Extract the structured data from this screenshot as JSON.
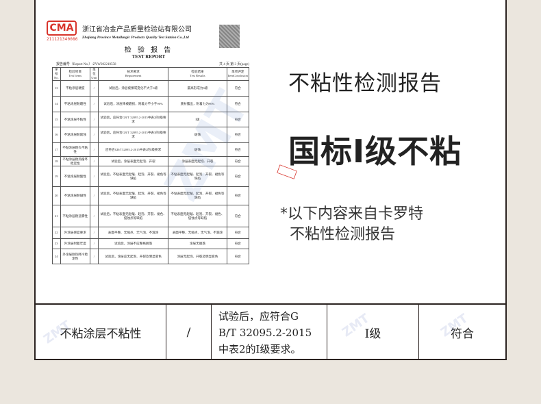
{
  "report": {
    "logo_text": "CMA",
    "logo_number": "211121340086",
    "org_cn": "浙江省冶金产品质量检验站有限公司",
    "org_en": "Zhejiang Province Metallurgic Products Quality Test Station Co.,Ltd",
    "title_cn": "检 验 报 告",
    "title_en": "TEST REPORT",
    "report_no": "报告编号（Report No.）:ZYW202210558",
    "page_info": "共 4 页 第 3 页(page)",
    "headers": [
      "序号\nNo.",
      "检验项目\nTest Items",
      "单位\nUnit",
      "技术要求\nRequirement",
      "检验结果\nTest Results",
      "单项评定\nItemConclusion"
    ],
    "rows": [
      {
        "no": "13",
        "item": "不粘涂层硬度",
        "unit": "/",
        "req": "试验后，涂层被擦或变化不大于6级",
        "result": "最高形成为6级",
        "conclusion": "符合"
      },
      {
        "no": "14",
        "item": "不粘涂层耐磨性",
        "unit": "/",
        "req": "试验后，涂层未被磨损，附着力不小于90%",
        "result": "底材露出，附着力为90%",
        "conclusion": "符合"
      },
      {
        "no": "15",
        "item": "不粘涂层不粘性",
        "unit": "/",
        "req": "试验后，应符合GB/T 32095.2-2015中表2的I级要求",
        "result": "I级",
        "conclusion": "符合"
      },
      {
        "no": "16",
        "item": "不粘涂层耐腐蚀",
        "unit": "/",
        "req": "试验后，应符合GB/T 32095.2-2015中表3的I级要求",
        "result": "斑蚀",
        "conclusion": "符合"
      },
      {
        "no": "17",
        "item": "不粘涂层耐久不粘性",
        "unit": "/",
        "req": "应符合GB/T32095.2-2015中表2的I级要求",
        "result": "斑蚀",
        "conclusion": "符合"
      },
      {
        "no": "18",
        "item": "不粘涂层耐热循环稳定性",
        "unit": "/",
        "req": "试验后，涂层表面无起泡、开裂",
        "result": "涂层表面无起泡、开裂",
        "conclusion": "符合"
      },
      {
        "no": "19",
        "item": "不粘涂层耐酸性",
        "unit": "/",
        "req": "试验后，不粘表面无起皱、起泡、开裂、褪色等缺陷",
        "result": "不粘表面无起皱、起泡、开裂、褪色等缺陷",
        "conclusion": "符合"
      },
      {
        "no": "20",
        "item": "不粘涂层耐碱性",
        "unit": "/",
        "req": "试验后，不粘表面无起皱、起泡、开裂、褪色等缺陷",
        "result": "不粘表面无起皱、起泡、开裂、褪色等缺陷",
        "conclusion": "符合"
      },
      {
        "no": "21",
        "item": "不粘涂层耐盐雾性",
        "unit": "/",
        "req": "试验后，不粘表面无起皱、起泡、开裂、褪色、侵蚀点等缺陷",
        "result": "不粘表面无起皱、起泡、开裂、褪色、侵蚀点等缺陷",
        "conclusion": "符合"
      },
      {
        "no": "22",
        "item": "外涂层感官要求",
        "unit": "/",
        "req": "表面平整、无缩点、无气泡、不漏涂",
        "result": "表面平整，无缩点、无气泡、不漏涂",
        "conclusion": "符合"
      },
      {
        "no": "23",
        "item": "外涂层附着牢度",
        "unit": "/",
        "req": "试验后，涂层不应整格脱落",
        "result": "涂层无脱落",
        "conclusion": "符合"
      },
      {
        "no": "24",
        "item": "外涂层耐热降冷稳定性",
        "unit": "/",
        "req": "试验后，涂层应无起泡、开裂及明显变色",
        "result": "涂层无起泡、开裂及明显变色",
        "conclusion": "符合"
      }
    ],
    "watermark": "ZMT"
  },
  "headline": "不粘性检测报告",
  "subheadline": "国标I级不粘",
  "note_line1": "*以下内容来自卡罗特",
  "note_line2": "不粘性检测报告",
  "summary_row": {
    "item": "不粘涂层不粘性",
    "unit": "/",
    "requirement": "试验后，应符合G\nB/T 32095.2-2015\n中表2的I级要求。",
    "result": "I级",
    "conclusion": "符合"
  },
  "colors": {
    "accent_red": "#d8342c",
    "border": "#2a2220",
    "background": "#ebe6de"
  }
}
